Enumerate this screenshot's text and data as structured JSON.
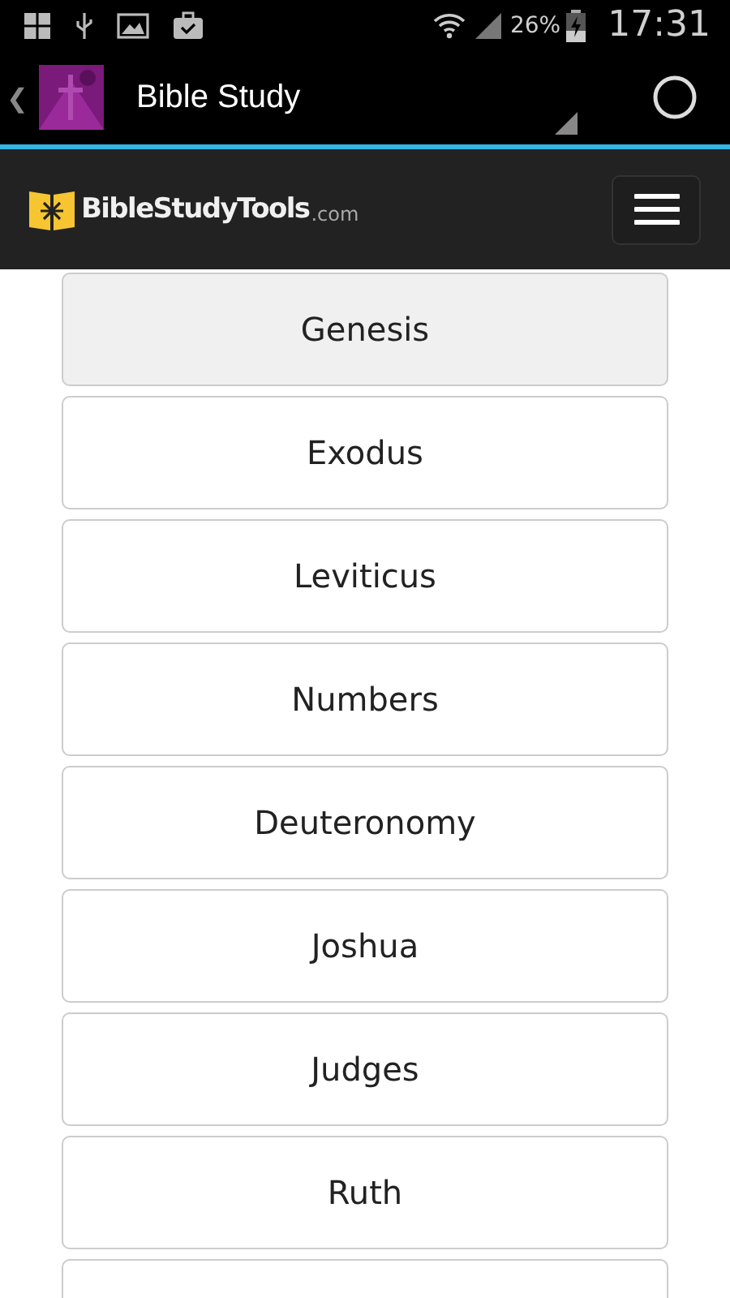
{
  "status_bar": {
    "battery": "26%",
    "time": "17:31"
  },
  "action_bar": {
    "title": "Bible Study",
    "back": "❮"
  },
  "site_header": {
    "logo_name": "BibleStudyTools",
    "logo_suffix": ".com"
  },
  "books": [
    {
      "label": "Genesis",
      "selected": true
    },
    {
      "label": "Exodus",
      "selected": false
    },
    {
      "label": "Leviticus",
      "selected": false
    },
    {
      "label": "Numbers",
      "selected": false
    },
    {
      "label": "Deuteronomy",
      "selected": false
    },
    {
      "label": "Joshua",
      "selected": false
    },
    {
      "label": "Judges",
      "selected": false
    },
    {
      "label": "Ruth",
      "selected": false
    }
  ]
}
